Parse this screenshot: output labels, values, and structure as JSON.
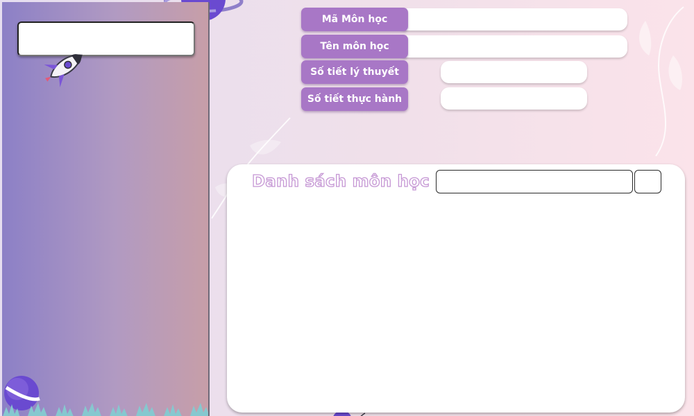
{
  "form": {
    "ma_mon_hoc_label": "Mã Môn học",
    "ten_mon_hoc_label": "Tên môn học",
    "so_tiet_ly_thuyet_label": "Số tiết lý thuyết",
    "so_tiet_thuc_hanh_label": "Số tiết thực hành",
    "ma_mon_hoc_value": "",
    "ten_mon_hoc_value": "",
    "so_tiet_ly_thuyet_value": "",
    "so_tiet_thuc_hanh_value": ""
  },
  "list_panel": {
    "title": "Danh sách môn học",
    "search_value": "",
    "button_label": ""
  },
  "sidebar": {
    "search_value": ""
  },
  "colors": {
    "label_bg": "#a877c6",
    "title_outline": "#c596d4",
    "sidebar_start": "#8c80c6",
    "sidebar_end": "#c79ea8"
  },
  "icons": [
    "rocket-icon",
    "planet-icon",
    "grass-decoration",
    "feather-decoration"
  ]
}
